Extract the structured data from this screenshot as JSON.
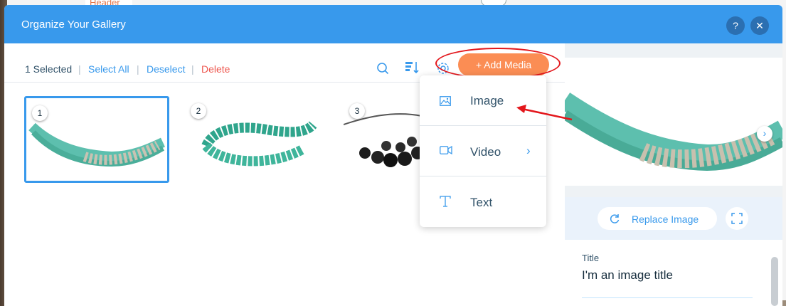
{
  "background": {
    "header_tab_label": "Header"
  },
  "dialog": {
    "title": "Organize Your Gallery",
    "help_label": "?",
    "close_label": "✕"
  },
  "toolbar": {
    "selected_count": "1 Selected",
    "select_all": "Select All",
    "deselect": "Deselect",
    "delete": "Delete",
    "separator": "|",
    "add_media": "+ Add Media"
  },
  "thumbnails": [
    {
      "number": "1",
      "selected": true,
      "icon": "turquoise-beaded-necklace"
    },
    {
      "number": "2",
      "selected": false,
      "icon": "twisted-turquoise-bracelet"
    },
    {
      "number": "3",
      "selected": false,
      "icon": "black-bead-necklace"
    }
  ],
  "add_media_menu": {
    "items": [
      {
        "label": "Image",
        "icon": "image-icon"
      },
      {
        "label": "Video",
        "icon": "video-icon",
        "has_submenu": true
      },
      {
        "label": "Text",
        "icon": "text-icon"
      }
    ]
  },
  "right_panel": {
    "replace_image": "Replace Image",
    "title_label": "Title",
    "title_value": "I'm an image title"
  },
  "colors": {
    "accent": "#3899ec",
    "add_media": "#fb8d54",
    "delete": "#ee5951",
    "annotation": "#e3161b"
  }
}
